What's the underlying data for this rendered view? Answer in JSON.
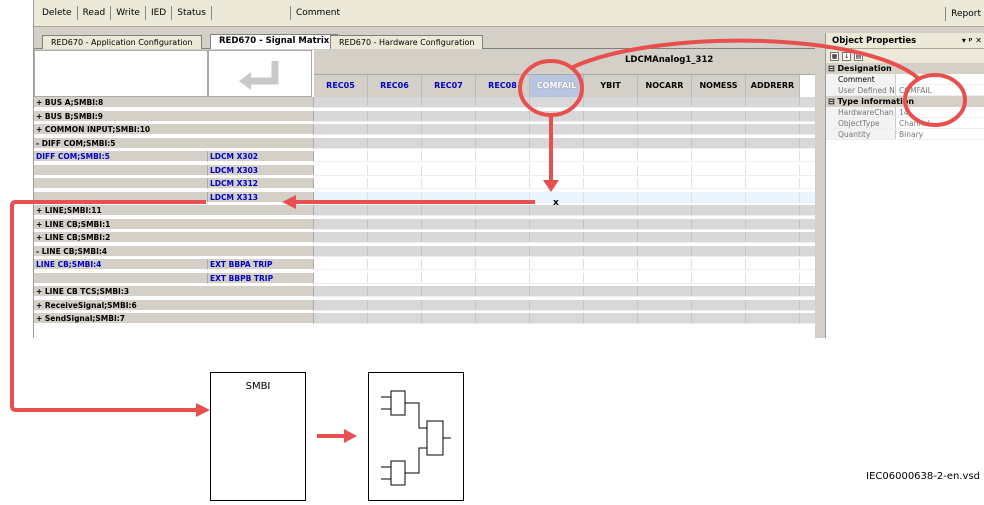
{
  "toolbar": {
    "buttons": [
      "Delete",
      "Read",
      "Write",
      "IED",
      "Status"
    ],
    "comment_label": "Comment",
    "report_label": "Report"
  },
  "tabs": [
    {
      "label": "RED670 - Application Configuration",
      "active": false
    },
    {
      "label": "RED670 - Signal Matrix",
      "active": true
    },
    {
      "label": "RED670 - Hardware Configuration",
      "active": false
    }
  ],
  "tab_controls": "▾ ◁ ▷ ✕",
  "matrix": {
    "group_header": "LDCMAnalog1_312",
    "columns": [
      "REC05",
      "REC06",
      "REC07",
      "REC08",
      "COMFAIL",
      "YBIT",
      "NOCARR",
      "NOMESS",
      "ADDRERR"
    ],
    "rows": [
      {
        "name": "+ BUS A;SMBI:8",
        "sub": "",
        "white": false
      },
      {
        "name": "+ BUS B;SMBI:9",
        "sub": "",
        "white": false
      },
      {
        "name": "+ COMMON INPUT;SMBI:10",
        "sub": "",
        "white": false
      },
      {
        "name": "- DIFF COM;SMBI:5",
        "sub": "",
        "white": false
      },
      {
        "name": "DIFF COM;SMBI:5",
        "sub": "LDCM X302",
        "white": true
      },
      {
        "name": "",
        "sub": "LDCM X303",
        "white": true
      },
      {
        "name": "",
        "sub": "LDCM X312",
        "white": true
      },
      {
        "name": "",
        "sub": "LDCM X313",
        "white": true
      },
      {
        "name": "+ LINE;SMBI:11",
        "sub": "",
        "white": false
      },
      {
        "name": "+ LINE CB;SMBI:1",
        "sub": "",
        "white": false
      },
      {
        "name": "+ LINE CB;SMBI:2",
        "sub": "",
        "white": false
      },
      {
        "name": "- LINE CB;SMBI:4",
        "sub": "",
        "white": false
      },
      {
        "name": "LINE CB;SMBI:4",
        "sub": "EXT BBPA TRIP",
        "white": true
      },
      {
        "name": "",
        "sub": "EXT BBPB TRIP",
        "white": true
      },
      {
        "name": "+ LINE CB TCS;SMBI:3",
        "sub": "",
        "white": false
      },
      {
        "name": "+ ReceiveSignal;SMBI:6",
        "sub": "",
        "white": false
      },
      {
        "name": "+ SendSignal;SMBI:7",
        "sub": "",
        "white": false
      }
    ],
    "mark": "x"
  },
  "properties": {
    "title": "Object Properties",
    "controls": "▾ ᵖ ✕",
    "categories": [
      {
        "name": "Designation",
        "rows": [
          {
            "key": "Comment",
            "value": "",
            "dark": true
          },
          {
            "key": "User Defined N",
            "value": "COMFAIL",
            "dark": false
          }
        ]
      },
      {
        "name": "Type information",
        "rows": [
          {
            "key": "HardwareChan",
            "value": "14",
            "dark": false
          },
          {
            "key": "ObjectType",
            "value": "Channel",
            "dark": false
          },
          {
            "key": "Quantity",
            "value": "Binary",
            "dark": false
          }
        ]
      }
    ]
  },
  "diagram": {
    "smbi_label": "SMBI",
    "caption": "IEC06000638-2-en.vsd"
  },
  "colors": {
    "accent_red": "#e8504f",
    "signal_blue": "#0000cc"
  }
}
